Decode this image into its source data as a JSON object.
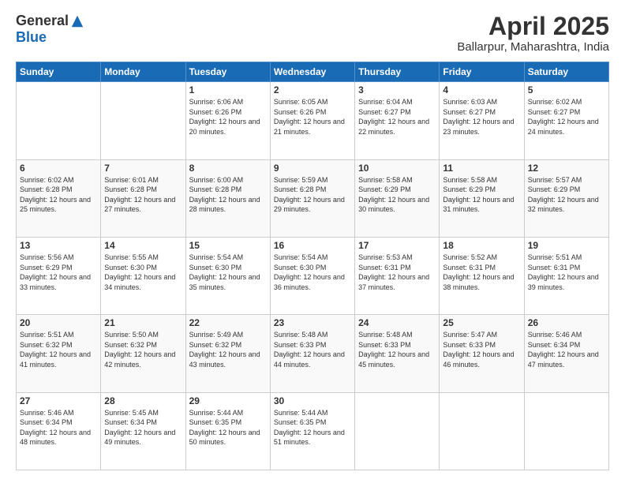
{
  "logo": {
    "general": "General",
    "blue": "Blue"
  },
  "header": {
    "month_title": "April 2025",
    "location": "Ballarpur, Maharashtra, India"
  },
  "days_of_week": [
    "Sunday",
    "Monday",
    "Tuesday",
    "Wednesday",
    "Thursday",
    "Friday",
    "Saturday"
  ],
  "weeks": [
    [
      {
        "day": "",
        "sunrise": "",
        "sunset": "",
        "daylight": ""
      },
      {
        "day": "",
        "sunrise": "",
        "sunset": "",
        "daylight": ""
      },
      {
        "day": "1",
        "sunrise": "Sunrise: 6:06 AM",
        "sunset": "Sunset: 6:26 PM",
        "daylight": "Daylight: 12 hours and 20 minutes."
      },
      {
        "day": "2",
        "sunrise": "Sunrise: 6:05 AM",
        "sunset": "Sunset: 6:26 PM",
        "daylight": "Daylight: 12 hours and 21 minutes."
      },
      {
        "day": "3",
        "sunrise": "Sunrise: 6:04 AM",
        "sunset": "Sunset: 6:27 PM",
        "daylight": "Daylight: 12 hours and 22 minutes."
      },
      {
        "day": "4",
        "sunrise": "Sunrise: 6:03 AM",
        "sunset": "Sunset: 6:27 PM",
        "daylight": "Daylight: 12 hours and 23 minutes."
      },
      {
        "day": "5",
        "sunrise": "Sunrise: 6:02 AM",
        "sunset": "Sunset: 6:27 PM",
        "daylight": "Daylight: 12 hours and 24 minutes."
      }
    ],
    [
      {
        "day": "6",
        "sunrise": "Sunrise: 6:02 AM",
        "sunset": "Sunset: 6:28 PM",
        "daylight": "Daylight: 12 hours and 25 minutes."
      },
      {
        "day": "7",
        "sunrise": "Sunrise: 6:01 AM",
        "sunset": "Sunset: 6:28 PM",
        "daylight": "Daylight: 12 hours and 27 minutes."
      },
      {
        "day": "8",
        "sunrise": "Sunrise: 6:00 AM",
        "sunset": "Sunset: 6:28 PM",
        "daylight": "Daylight: 12 hours and 28 minutes."
      },
      {
        "day": "9",
        "sunrise": "Sunrise: 5:59 AM",
        "sunset": "Sunset: 6:28 PM",
        "daylight": "Daylight: 12 hours and 29 minutes."
      },
      {
        "day": "10",
        "sunrise": "Sunrise: 5:58 AM",
        "sunset": "Sunset: 6:29 PM",
        "daylight": "Daylight: 12 hours and 30 minutes."
      },
      {
        "day": "11",
        "sunrise": "Sunrise: 5:58 AM",
        "sunset": "Sunset: 6:29 PM",
        "daylight": "Daylight: 12 hours and 31 minutes."
      },
      {
        "day": "12",
        "sunrise": "Sunrise: 5:57 AM",
        "sunset": "Sunset: 6:29 PM",
        "daylight": "Daylight: 12 hours and 32 minutes."
      }
    ],
    [
      {
        "day": "13",
        "sunrise": "Sunrise: 5:56 AM",
        "sunset": "Sunset: 6:29 PM",
        "daylight": "Daylight: 12 hours and 33 minutes."
      },
      {
        "day": "14",
        "sunrise": "Sunrise: 5:55 AM",
        "sunset": "Sunset: 6:30 PM",
        "daylight": "Daylight: 12 hours and 34 minutes."
      },
      {
        "day": "15",
        "sunrise": "Sunrise: 5:54 AM",
        "sunset": "Sunset: 6:30 PM",
        "daylight": "Daylight: 12 hours and 35 minutes."
      },
      {
        "day": "16",
        "sunrise": "Sunrise: 5:54 AM",
        "sunset": "Sunset: 6:30 PM",
        "daylight": "Daylight: 12 hours and 36 minutes."
      },
      {
        "day": "17",
        "sunrise": "Sunrise: 5:53 AM",
        "sunset": "Sunset: 6:31 PM",
        "daylight": "Daylight: 12 hours and 37 minutes."
      },
      {
        "day": "18",
        "sunrise": "Sunrise: 5:52 AM",
        "sunset": "Sunset: 6:31 PM",
        "daylight": "Daylight: 12 hours and 38 minutes."
      },
      {
        "day": "19",
        "sunrise": "Sunrise: 5:51 AM",
        "sunset": "Sunset: 6:31 PM",
        "daylight": "Daylight: 12 hours and 39 minutes."
      }
    ],
    [
      {
        "day": "20",
        "sunrise": "Sunrise: 5:51 AM",
        "sunset": "Sunset: 6:32 PM",
        "daylight": "Daylight: 12 hours and 41 minutes."
      },
      {
        "day": "21",
        "sunrise": "Sunrise: 5:50 AM",
        "sunset": "Sunset: 6:32 PM",
        "daylight": "Daylight: 12 hours and 42 minutes."
      },
      {
        "day": "22",
        "sunrise": "Sunrise: 5:49 AM",
        "sunset": "Sunset: 6:32 PM",
        "daylight": "Daylight: 12 hours and 43 minutes."
      },
      {
        "day": "23",
        "sunrise": "Sunrise: 5:48 AM",
        "sunset": "Sunset: 6:33 PM",
        "daylight": "Daylight: 12 hours and 44 minutes."
      },
      {
        "day": "24",
        "sunrise": "Sunrise: 5:48 AM",
        "sunset": "Sunset: 6:33 PM",
        "daylight": "Daylight: 12 hours and 45 minutes."
      },
      {
        "day": "25",
        "sunrise": "Sunrise: 5:47 AM",
        "sunset": "Sunset: 6:33 PM",
        "daylight": "Daylight: 12 hours and 46 minutes."
      },
      {
        "day": "26",
        "sunrise": "Sunrise: 5:46 AM",
        "sunset": "Sunset: 6:34 PM",
        "daylight": "Daylight: 12 hours and 47 minutes."
      }
    ],
    [
      {
        "day": "27",
        "sunrise": "Sunrise: 5:46 AM",
        "sunset": "Sunset: 6:34 PM",
        "daylight": "Daylight: 12 hours and 48 minutes."
      },
      {
        "day": "28",
        "sunrise": "Sunrise: 5:45 AM",
        "sunset": "Sunset: 6:34 PM",
        "daylight": "Daylight: 12 hours and 49 minutes."
      },
      {
        "day": "29",
        "sunrise": "Sunrise: 5:44 AM",
        "sunset": "Sunset: 6:35 PM",
        "daylight": "Daylight: 12 hours and 50 minutes."
      },
      {
        "day": "30",
        "sunrise": "Sunrise: 5:44 AM",
        "sunset": "Sunset: 6:35 PM",
        "daylight": "Daylight: 12 hours and 51 minutes."
      },
      {
        "day": "",
        "sunrise": "",
        "sunset": "",
        "daylight": ""
      },
      {
        "day": "",
        "sunrise": "",
        "sunset": "",
        "daylight": ""
      },
      {
        "day": "",
        "sunrise": "",
        "sunset": "",
        "daylight": ""
      }
    ]
  ]
}
